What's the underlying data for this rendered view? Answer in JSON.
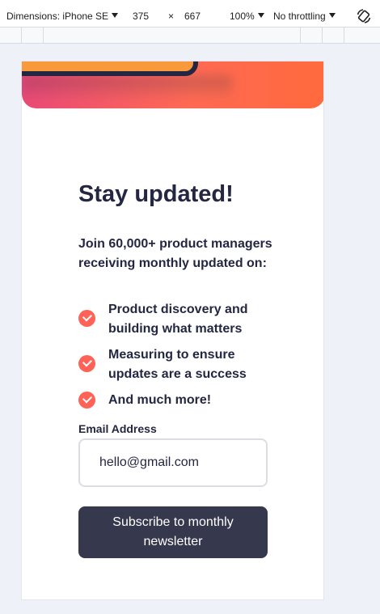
{
  "devtools": {
    "device_label": "Dimensions: iPhone SE",
    "width": "375",
    "separator": "×",
    "height": "667",
    "zoom": "100%",
    "throttling": "No throttling"
  },
  "page": {
    "title": "Stay updated!",
    "intro": "Join 60,000+ product managers receiving monthly updated on:",
    "features": [
      "Product discovery and building what matters",
      "Measuring to ensure updates are a success",
      "And much more!"
    ],
    "email_label": "Email Address",
    "email_value": "hello@gmail.com",
    "subscribe_label": "Subscribe to monthly newsletter"
  },
  "colors": {
    "accent": "#ff6257",
    "dark": "#242742",
    "button": "#36384e"
  }
}
